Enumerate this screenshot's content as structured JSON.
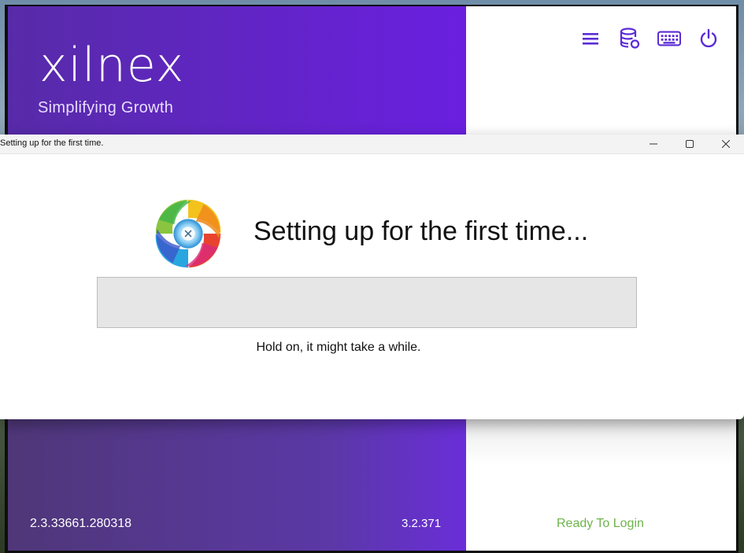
{
  "app": {
    "logo_text": "xilnex",
    "tagline": "Simplifying Growth",
    "version_primary": "2.3.33661.280318",
    "version_secondary": "3.2.371",
    "status": "Ready To Login",
    "toolbar_icons": [
      "menu-icon",
      "database-sync-icon",
      "keyboard-icon",
      "power-icon"
    ]
  },
  "setup_dialog": {
    "title": "Setting up for the first time.",
    "heading": "Setting up for the first time...",
    "message": "Hold on, it might take a while.",
    "progress": 0,
    "window_controls": {
      "minimize": "–",
      "maximize": "☐",
      "close": "✕"
    }
  },
  "colors": {
    "brand_purple": "#6a1fe0",
    "status_green": "#6db34b"
  }
}
